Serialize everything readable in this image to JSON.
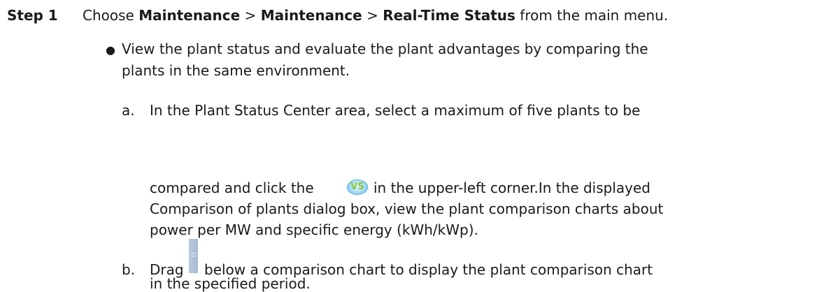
{
  "step": {
    "label": "Step 1",
    "choose": "Choose ",
    "menu_1": "Maintenance",
    "sep_1": " > ",
    "menu_2": "Maintenance",
    "sep_2": " > ",
    "menu_3": "Real-Time Status",
    "suffix": " from the main menu."
  },
  "bullet": {
    "symbol": "●",
    "line_1": "View the plant status and evaluate the plant advantages by comparing the",
    "line_2": "plants in the same environment."
  },
  "item_a": {
    "marker": "a.",
    "line_1": "In the Plant Status Center area, select a maximum of five plants to be",
    "line_2_before": "compared and click the",
    "line_2_after": "in the upper-left corner.In the displayed",
    "line_3": "Comparison of plants dialog box, view the plant comparison charts about",
    "line_4": "power per MW and specific energy (kWh/kWp).",
    "icon_text": "VS"
  },
  "item_b": {
    "marker": "b.",
    "line_1_before": "Drag",
    "line_1_after": "below a comparison chart to display the plant comparison chart",
    "line_2": "in the specified period."
  },
  "colors": {
    "text": "#1a1a1a",
    "vs_icon_fill": "#a6dbf3",
    "vs_icon_text": "#8ac63c",
    "drag_handle": "#b0c2d6"
  },
  "icons": {
    "vs": "vs-compare-icon",
    "drag": "drag-handle-icon"
  }
}
